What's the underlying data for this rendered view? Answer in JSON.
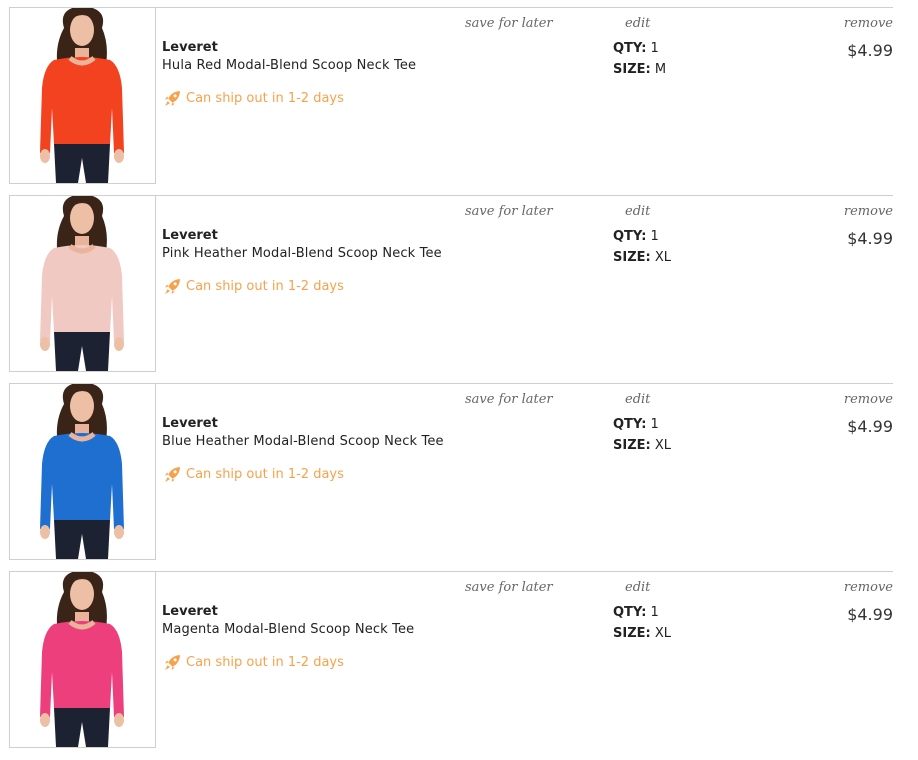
{
  "cart": {
    "items": [
      {
        "save_label": "save for later",
        "edit_label": "edit",
        "remove_label": "remove",
        "brand": "Leveret",
        "name": "Hula Red Modal-Blend Scoop Neck Tee",
        "shipping": "Can ship out in 1-2 days",
        "qty_label": "QTY:",
        "qty": "1",
        "size_label": "SIZE:",
        "size": "M",
        "price": "$4.99",
        "shirt_color": "#f2421f"
      },
      {
        "save_label": "save for later",
        "edit_label": "edit",
        "remove_label": "remove",
        "brand": "Leveret",
        "name": "Pink Heather Modal-Blend Scoop Neck Tee",
        "shipping": "Can ship out in 1-2 days",
        "qty_label": "QTY:",
        "qty": "1",
        "size_label": "SIZE:",
        "size": "XL",
        "price": "$4.99",
        "shirt_color": "#f0c9c2"
      },
      {
        "save_label": "save for later",
        "edit_label": "edit",
        "remove_label": "remove",
        "brand": "Leveret",
        "name": "Blue Heather Modal-Blend Scoop Neck Tee",
        "shipping": "Can ship out in 1-2 days",
        "qty_label": "QTY:",
        "qty": "1",
        "size_label": "SIZE:",
        "size": "XL",
        "price": "$4.99",
        "shirt_color": "#1f6fd0"
      },
      {
        "save_label": "save for later",
        "edit_label": "edit",
        "remove_label": "remove",
        "brand": "Leveret",
        "name": "Magenta Modal-Blend Scoop Neck Tee",
        "shipping": "Can ship out in 1-2 days",
        "qty_label": "QTY:",
        "qty": "1",
        "size_label": "SIZE:",
        "size": "XL",
        "price": "$4.99",
        "shirt_color": "#ec3f7c"
      }
    ],
    "shipping_color": "#f7a24b",
    "shipping_icon": "rocket-icon"
  }
}
